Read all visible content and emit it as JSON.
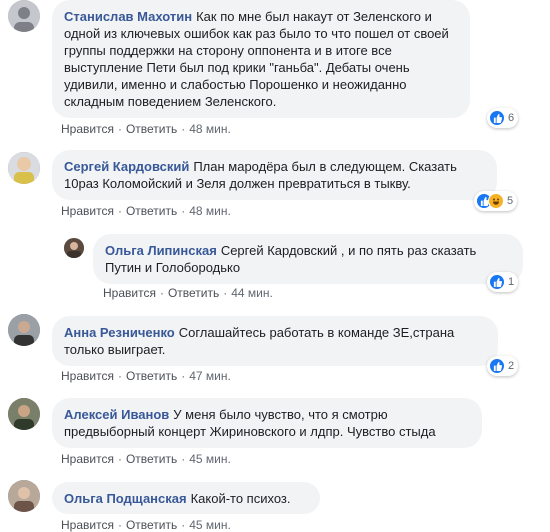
{
  "actions": {
    "like": "Нравится",
    "reply": "Ответить",
    "dot": "·"
  },
  "comments": [
    {
      "author": "Станислав Махотин",
      "text": "Как по мне был накаут от Зеленского и одной из ключевых ошибок как раз было то что пошел от своей группы поддержки на сторону оппонента и в итоге все выступление Пети был под крики \"ганьба\". Дебаты очень удивили, именно и слабостью Порошенко и неожиданно складным поведением Зеленского.",
      "time": "48 мин.",
      "reaction_count": "6"
    },
    {
      "author": "Сергей Кардовский",
      "text": "План мародёра был в следующем. Сказать 10раз Коломойский и Зеля должен превратиться в тыкву.",
      "time": "48 мин.",
      "reaction_count": "5"
    },
    {
      "author": "Ольга Липинская",
      "text": "Сергей Кардовский , и по пять раз сказать Путин и Голобородько",
      "time": "44 мин.",
      "reaction_count": "1"
    },
    {
      "author": "Анна Резниченко",
      "text": "Соглашайтесь работать в команде ЗЕ,страна только выиграет.",
      "time": "47 мин.",
      "reaction_count": "2"
    },
    {
      "author": "Алексей Иванов",
      "text": "У меня было чувство, что я смотрю предвыборный концерт Жириновского и лдпр. Чувство стыда",
      "time": "45 мин.",
      "reaction_count": ""
    },
    {
      "author": "Ольга Подщанская",
      "text": "Какой-то психоз.",
      "time": "45 мин.",
      "reaction_count": ""
    }
  ],
  "colors": {
    "author": "#385898",
    "bubble": "#f2f3f5",
    "like": "#1877f2",
    "haha": "#f7b125"
  }
}
